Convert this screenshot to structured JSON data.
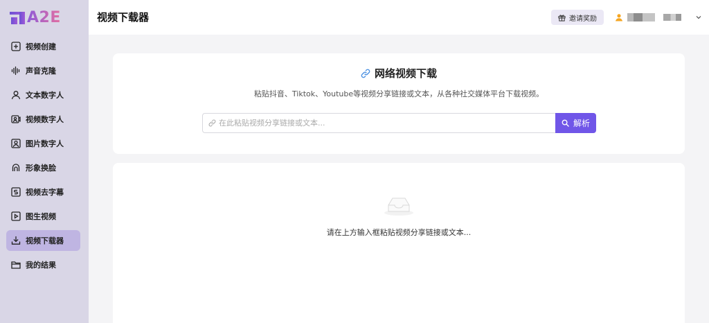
{
  "logo": {
    "text": "A2E"
  },
  "sidebar": {
    "items": [
      {
        "label": "视频创建",
        "icon": "plus-square-icon",
        "active": false
      },
      {
        "label": "声音克隆",
        "icon": "waveform-icon",
        "active": false
      },
      {
        "label": "文本数字人",
        "icon": "user-icon",
        "active": false
      },
      {
        "label": "视频数字人",
        "icon": "video-user-icon",
        "active": false
      },
      {
        "label": "图片数字人",
        "icon": "image-user-icon",
        "active": false
      },
      {
        "label": "形象换脸",
        "icon": "face-swap-icon",
        "active": false
      },
      {
        "label": "视频去字幕",
        "icon": "remove-subtitle-icon",
        "active": false
      },
      {
        "label": "图生视频",
        "icon": "play-square-icon",
        "active": false
      },
      {
        "label": "视频下载器",
        "icon": "download-icon",
        "active": true
      },
      {
        "label": "我的结果",
        "icon": "folder-icon",
        "active": false
      }
    ]
  },
  "header": {
    "title": "视频下载器",
    "invite_label": "邀请奖励"
  },
  "downloader": {
    "title": "网络视频下载",
    "subtitle": "粘贴抖音、Tiktok、Youtube等视频分享链接或文本，从各种社交媒体平台下载视频。",
    "input_placeholder": "在此粘贴视频分享链接或文本...",
    "input_value": "",
    "parse_label": "解析"
  },
  "empty_state": {
    "text": "请在上方输入框粘贴视频分享链接或文本..."
  },
  "colors": {
    "accent": "#7056e8",
    "sidebar_bg": "#d9d6e6",
    "sidebar_active": "#bfb5e2",
    "user_icon": "#f5a623"
  }
}
